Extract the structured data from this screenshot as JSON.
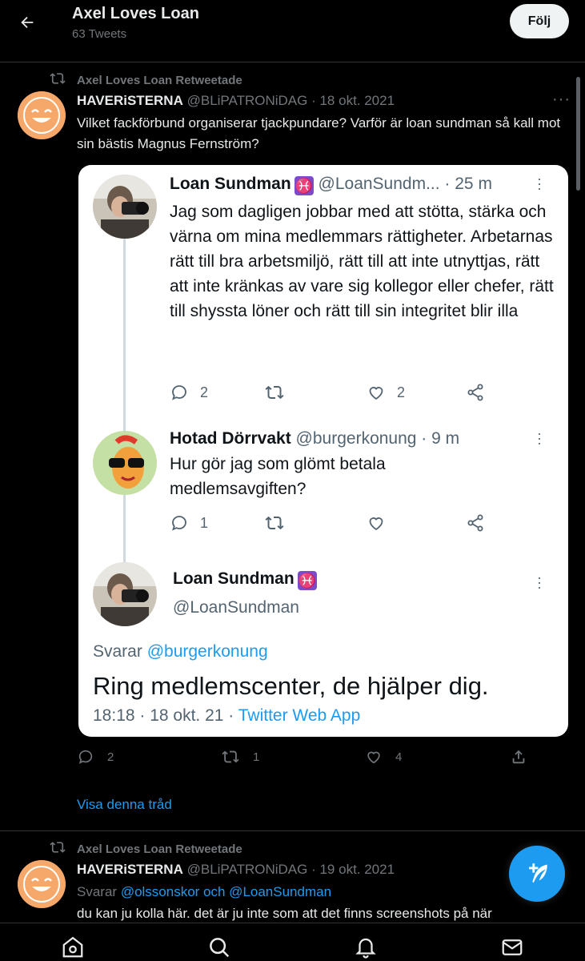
{
  "header": {
    "title": "Axel Loves Loan",
    "tweet_count": "63 Tweets",
    "follow_label": "Följ"
  },
  "tweet1": {
    "retweet_label": "Axel Loves Loan Retweetade",
    "name": "HAVERiSTERNA",
    "handle_date": "@BLiPATRONiDAG · 18 okt. 2021",
    "text": "Vilket fackförbund organiserar tjackpundare? Varför är loan sundman så kall mot sin bästis Magnus Fernström?",
    "replies": "2",
    "retweets": "1",
    "likes": "4",
    "show_thread": "Visa denna tråd"
  },
  "screenshot": {
    "post1": {
      "name": "Loan Sundman",
      "meta": "@LoanSundm... · 25 m",
      "text": "Jag som dagligen jobbar med att stötta, stärka och värna om mina medlemmars rättigheter. Arbetarnas rätt till bra arbetsmiljö, rätt till att inte utnyttjas, rätt att inte kränkas av vare sig kollegor eller chefer, rätt till shyssta löner och rätt till sin integritet blir illa",
      "replies": "2",
      "likes": "2"
    },
    "post2": {
      "name": "Hotad Dörrvakt",
      "meta": "@burgerkonung · 9 m",
      "text": "Hur gör jag som glömt betala medlemsavgiften?",
      "replies": "1"
    },
    "post3": {
      "name": "Loan Sundman",
      "handle": "@LoanSundman",
      "replying_prefix": "Svarar",
      "replying_to": "@burgerkonung",
      "text": "Ring medlemscenter, de hjälper dig.",
      "time": "18:18 · 18 okt. 21 ·",
      "source": "Twitter Web App"
    },
    "pisces_symbol": "♓"
  },
  "tweet2": {
    "retweet_label": "Axel Loves Loan Retweetade",
    "name": "HAVERiSTERNA",
    "handle_date": "@BLiPATRONiDAG · 19 okt. 2021",
    "replying_prefix": "Svarar",
    "replying_to": "@olssonskor och @LoanSundman",
    "text": "du kan ju kolla här. det är ju inte som att det finns screenshots på när"
  },
  "colors": {
    "background": "#000000",
    "accent": "#1d9bf0",
    "secondary_text": "#71767b",
    "card_background": "#ffffff"
  },
  "icons": [
    "back-arrow-icon",
    "retweet-icon",
    "more-icon",
    "reply-icon",
    "like-icon",
    "share-icon",
    "compose-icon",
    "home-icon",
    "search-icon",
    "notifications-icon",
    "messages-icon"
  ]
}
